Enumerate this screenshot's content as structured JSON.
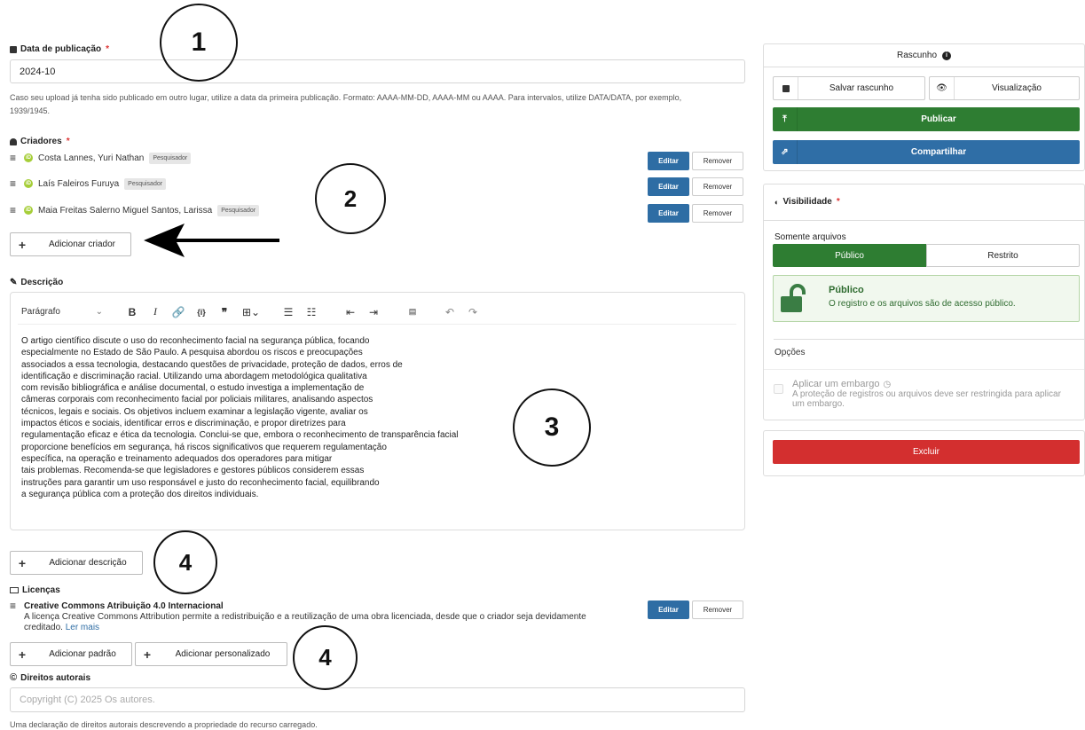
{
  "pub_date": {
    "label": "Data de publicação",
    "required_mark": "*",
    "value": "2024-10",
    "help_line1": "Caso seu upload já tenha sido publicado em outro lugar, utilize a data da primeira publicação. Formato: AAAA-MM-DD, AAAA-MM ou AAAA. Para intervalos, utilize DATA/DATA, por exemplo,",
    "help_line2": "1939/1945."
  },
  "creators": {
    "label": "Criadores",
    "required_mark": "*",
    "items": [
      {
        "name": "Costa Lannes, Yuri Nathan",
        "role": "Pesquisador",
        "edit": "Editar",
        "remove": "Remover"
      },
      {
        "name": "Laís Faleiros Furuya",
        "role": "Pesquisador",
        "edit": "Editar",
        "remove": "Remover"
      },
      {
        "name": "Maia Freitas Salerno Miguel Santos, Larissa",
        "role": "Pesquisador",
        "edit": "Editar",
        "remove": "Remover"
      }
    ],
    "add_label": "Adicionar criador"
  },
  "description": {
    "label": "Descrição",
    "format_select": "Parágrafo",
    "text": "O artigo científico discute o uso do reconhecimento facial na segurança pública, focando\nespecialmente no Estado de São Paulo. A pesquisa abordou os riscos e preocupações\nassociados a essa tecnologia, destacando questões de privacidade, proteção de dados, erros de\nidentificação e discriminação racial. Utilizando uma abordagem metodológica qualitativa\ncom revisão bibliográfica e análise documental, o estudo investiga a implementação de\ncâmeras corporais com reconhecimento facial por policiais militares, analisando aspectos\ntécnicos, legais e sociais. Os objetivos incluem examinar a legislação vigente, avaliar os\nimpactos éticos e sociais, identificar erros e discriminação, e propor diretrizes para\nregulamentação eficaz e ética da tecnologia. Conclui-se que, embora o reconhecimento de transparência facial\nproporcione benefícios em segurança, há riscos significativos que requerem regulamentação\nespecífica, na operação e treinamento adequados dos operadores para mitigar\ntais problemas. Recomenda-se que legisladores e gestores públicos considerem essas\ninstruções para garantir um uso responsável e justo do reconhecimento facial, equilibrando\na segurança pública com a proteção dos direitos individuais.",
    "add_label": "Adicionar descrição"
  },
  "licenses": {
    "label": "Licenças",
    "item_title": "Creative Commons Atribuição 4.0 Internacional",
    "item_desc_line1": "A licença Creative Commons Attribution permite a redistribuição e a reutilização de uma obra licenciada, desde que o criador seja devidamente",
    "item_desc_line2": "creditado.",
    "read_more": "Ler mais",
    "edit": "Editar",
    "remove": "Remover",
    "add_standard": "Adicionar padrão",
    "add_custom": "Adicionar personalizado"
  },
  "copyright": {
    "label": "Direitos autorais",
    "placeholder": "Copyright (C) 2025 Os autores.",
    "help": "Uma declaração de direitos autorais descrevendo a propriedade do recurso carregado."
  },
  "annotations": [
    "1",
    "2",
    "3",
    "4",
    "4"
  ],
  "sidebar": {
    "status": "Rascunho",
    "save_draft": "Salvar rascunho",
    "preview": "Visualização",
    "publish": "Publicar",
    "share": "Compartilhar",
    "visibility_label": "Visibilidade",
    "required_mark": "*",
    "files_only": "Somente arquivos",
    "public_tab": "Público",
    "restricted_tab": "Restrito",
    "public_title": "Público",
    "public_desc": "O registro e os arquivos são de acesso público.",
    "options": "Opções",
    "embargo_label": "Aplicar um embargo",
    "embargo_desc_line1": "A proteção de registros ou arquivos deve ser restringida para aplicar",
    "embargo_desc_line2": "um embargo.",
    "delete": "Excluir"
  },
  "colors": {
    "primary_blue": "#2e6da4",
    "publish_green": "#2e7d32",
    "share_blue": "#2f6ea6",
    "delete_red": "#d32f2f",
    "public_bg": "#f1f8ee"
  }
}
